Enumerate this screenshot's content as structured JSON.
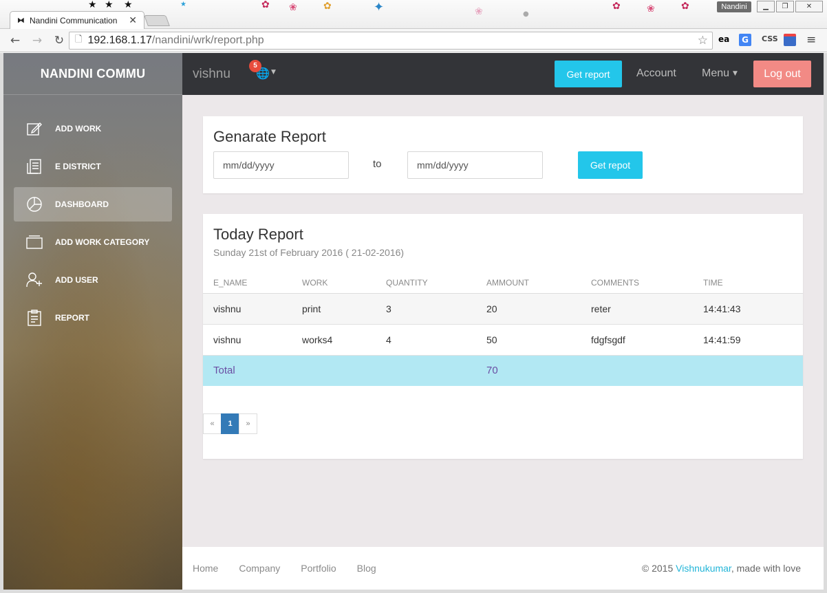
{
  "browser": {
    "tab_title": "Nandini Communication",
    "tab_close": "✕",
    "profile_name": "Nandini",
    "url_host": "192.168.1.17",
    "url_path": "/nandini/wrk/report.php",
    "extensions": [
      "ea",
      "G",
      "CSS",
      "keyboard"
    ],
    "window_buttons": [
      "minimize",
      "restore",
      "close"
    ]
  },
  "sidebar": {
    "brand": "NANDINI COMMU",
    "items": [
      {
        "label": "ADD WORK",
        "icon": "edit-icon",
        "active": false
      },
      {
        "label": "E DISTRICT",
        "icon": "document-icon",
        "active": false
      },
      {
        "label": "DASHBOARD",
        "icon": "pie-chart-icon",
        "active": true
      },
      {
        "label": "ADD WORK CATEGORY",
        "icon": "folder-icon",
        "active": false
      },
      {
        "label": "ADD USER",
        "icon": "add-user-icon",
        "active": false
      },
      {
        "label": "REPORT",
        "icon": "clipboard-icon",
        "active": false
      }
    ]
  },
  "topnav": {
    "user": "vishnu",
    "notification_count": "5",
    "get_report": "Get report",
    "account": "Account",
    "menu": "Menu",
    "logout": "Log out"
  },
  "generate": {
    "title": "Genarate Report",
    "from_placeholder": "mm/dd/yyyy",
    "to_label": "to",
    "to_placeholder": "mm/dd/yyyy",
    "button": "Get repot"
  },
  "today": {
    "title": "Today Report",
    "subtitle": "Sunday 21st of February 2016 ( 21-02-2016)",
    "columns": [
      "E_NAME",
      "WORK",
      "QUANTITY",
      "AMMOUNT",
      "COMMENTS",
      "TIME"
    ],
    "rows": [
      [
        "vishnu",
        "print",
        "3",
        "20",
        "reter",
        "14:41:43"
      ],
      [
        "vishnu",
        "works4",
        "4",
        "50",
        "fdgfsgdf",
        "14:41:59"
      ]
    ],
    "total_label": "Total",
    "total_amount": "70",
    "pager": {
      "prev": "«",
      "current": "1",
      "next": "»"
    }
  },
  "footer": {
    "links": [
      "Home",
      "Company",
      "Portfolio",
      "Blog"
    ],
    "copyright_prefix": "© 2015 ",
    "author": "Vishnukumar",
    "copyright_suffix": ", made with love"
  },
  "colors": {
    "accent": "#23c6ea",
    "logout": "#f28a85",
    "topnav": "#333438",
    "content_bg": "#ece8ea",
    "total_row": "#b2e8f3"
  }
}
